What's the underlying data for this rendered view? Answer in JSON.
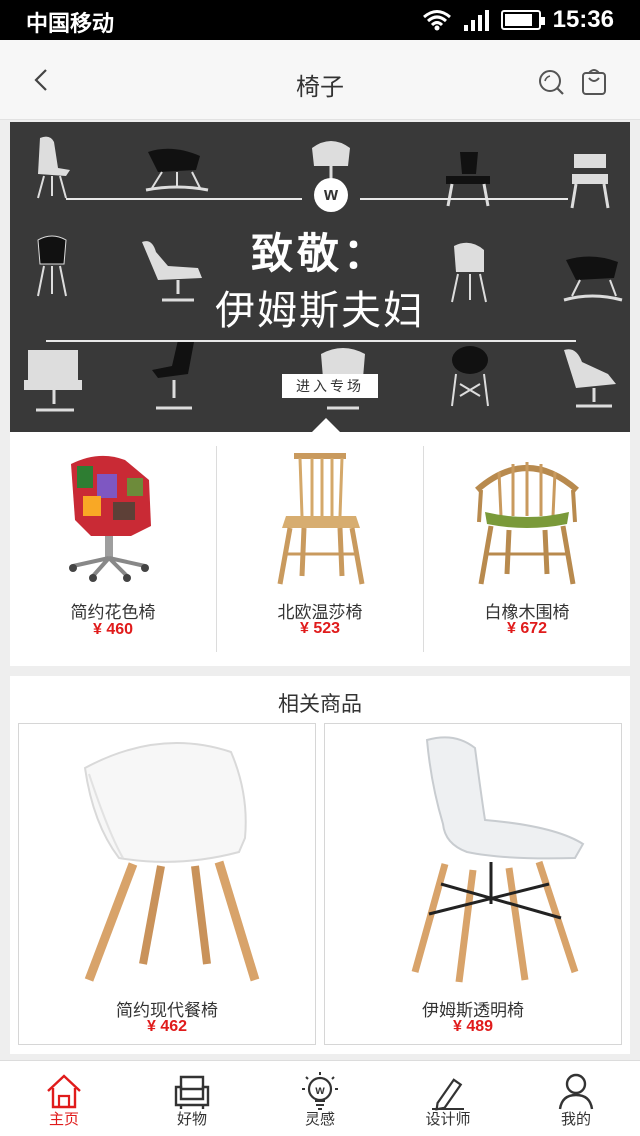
{
  "status_bar": {
    "carrier": "中国移动",
    "time": "15:36",
    "battery_level": 0.85,
    "icons": [
      "wifi-icon",
      "signal-icon",
      "battery-icon"
    ]
  },
  "nav": {
    "title": "椅子",
    "icons": [
      "back-icon",
      "search-icon",
      "shopping-bag-icon"
    ]
  },
  "banner": {
    "logo": "w",
    "headline": "致敬：",
    "subheadline": "伊姆斯夫妇",
    "cta": "进入专场"
  },
  "products": [
    {
      "name": "简约花色椅",
      "price": "¥ 460"
    },
    {
      "name": "北欧温莎椅",
      "price": "¥ 523"
    },
    {
      "name": "白橡木围椅",
      "price": "¥ 672"
    }
  ],
  "related": {
    "title": "相关商品",
    "items": [
      {
        "name": "简约现代餐椅",
        "price": "¥ 462"
      },
      {
        "name": "伊姆斯透明椅",
        "price": "¥ 489"
      }
    ]
  },
  "tabs": [
    {
      "label": "主页",
      "icon": "home-icon",
      "active": true
    },
    {
      "label": "好物",
      "icon": "sofa-icon",
      "active": false
    },
    {
      "label": "灵感",
      "icon": "lightbulb-icon",
      "active": false
    },
    {
      "label": "设计师",
      "icon": "pencil-icon",
      "active": false
    },
    {
      "label": "我的",
      "icon": "user-icon",
      "active": false
    }
  ],
  "colors": {
    "accent": "#e01b1b",
    "banner_bg": "#393939",
    "page_bg": "#eeeeee"
  }
}
